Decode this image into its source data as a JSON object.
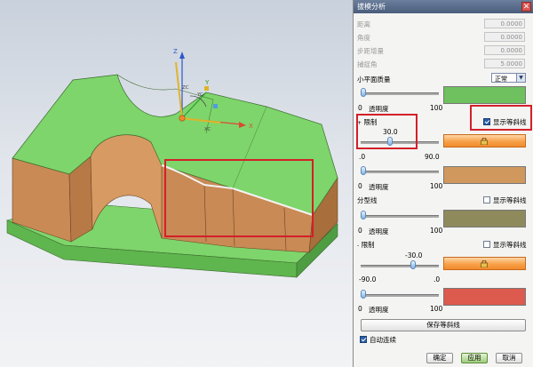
{
  "dialog": {
    "title": "拔模分析",
    "close_glyph": "✕",
    "readouts": [
      {
        "label": "距离",
        "value": "0.0000"
      },
      {
        "label": "角度",
        "value": "0.0000"
      },
      {
        "label": "步距增量",
        "value": "0.0000"
      },
      {
        "label": "捕捉角",
        "value": "5.0000"
      }
    ],
    "small_plane_quality": {
      "label": "小平面质量",
      "selected": "正常"
    },
    "transparency_label": "透明度",
    "transparency_min": "0",
    "transparency_max": "100",
    "limit1": {
      "label": "限制",
      "caret": "+",
      "show_isoclines": "显示等斜线",
      "value": "30.0",
      "range_min": ".0",
      "range_max": "90.0"
    },
    "parting": {
      "label": "分型线",
      "show_isoclines": "显示等斜线"
    },
    "limit2": {
      "label": "限制",
      "caret": "-",
      "show_isoclines": "显示等斜线",
      "value": "-30.0",
      "range_min": "-90.0",
      "range_max": ".0"
    },
    "save_button": "保存等斜线",
    "auto_update": "自动连续",
    "ok_button": "确定",
    "apply_button": "应用",
    "cancel_button": "取消"
  },
  "colors": {
    "surface_green": "#7ed56b",
    "swatch_green": "#6fc05f",
    "swatch_tan": "#d1985e",
    "swatch_olive": "#8f8a5c",
    "swatch_red": "#dd5a4e",
    "annotation_red": "#d3202a"
  },
  "icons": {
    "lock": "lock-icon",
    "close": "close-icon",
    "dropdown": "chevron-down-icon"
  },
  "triad": {
    "x": "X",
    "y": "Y",
    "z": "Z",
    "xc": "XC",
    "yc": "YC",
    "zc": "ZC"
  }
}
